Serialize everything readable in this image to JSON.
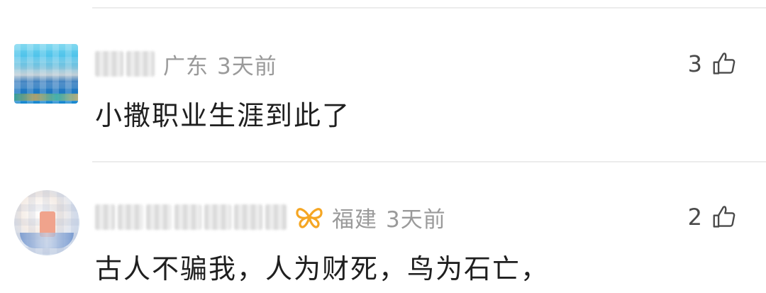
{
  "comments": [
    {
      "location": "广东",
      "time": "3天前",
      "text": "小撒职业生涯到此了",
      "likes": "3",
      "avatar_icon": "blurred-ocean-avatar",
      "has_vip_badge": false
    },
    {
      "location": "福建",
      "time": "3天前",
      "text": "古人不骗我，人为财死，鸟为石亡，",
      "likes": "2",
      "avatar_icon": "blurred-portrait-avatar",
      "has_vip_badge": true,
      "vip_badge_color": "#f5a623"
    }
  ],
  "like_icon": "thumbs-up-icon"
}
